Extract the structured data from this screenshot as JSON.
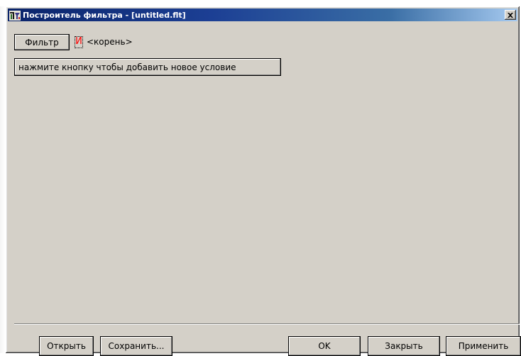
{
  "window": {
    "title": "Построитель фильтра - [untitled.flt]",
    "icon": "filter-builder-app-icon",
    "close_icon": "close-icon"
  },
  "filter": {
    "filter_button_label": "Фильтр",
    "operator_label": "И",
    "operator_color": "#ff0000",
    "root_label": "<корень>",
    "add_condition_label": "нажмите кнопку чтобы добавить новое условие"
  },
  "footer": {
    "open_label": "Открыть",
    "save_label": "Сохранить...",
    "ok_label": "OK",
    "close_label": "Закрыть",
    "apply_label": "Применить"
  },
  "colors": {
    "face": "#d4d0c8",
    "title_gradient_start": "#0a246a",
    "title_gradient_end": "#a6caf0"
  }
}
